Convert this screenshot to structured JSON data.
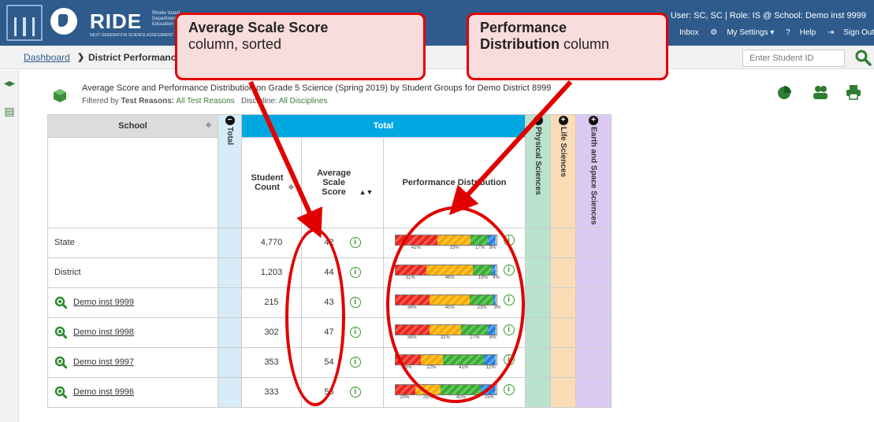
{
  "header": {
    "brand": "RIDE",
    "brand_sub": "Rhode Island Department of Education",
    "brand_tag": "NEXT GENERATION SCIENCE ASSESSMENT",
    "user_line": "User: SC, SC | Role: IS @ School: Demo inst 9999",
    "nav": {
      "inbox": "Inbox",
      "settings": "My Settings ▾",
      "help": "Help",
      "signout": "Sign Out"
    }
  },
  "breadcrumb": {
    "root": "Dashboard",
    "separator": "❯",
    "current": "District Performance"
  },
  "student_search": {
    "placeholder": "Enter Student ID"
  },
  "report": {
    "title": "Average Score and Performance Distribution on Grade 5 Science (Spring 2019) by Student Groups for Demo District 8999",
    "filter_label": "Filtered by",
    "filter_test_reasons": "Test Reasons:",
    "filter_test_reasons_value": "All Test Reasons",
    "filter_discipline": "Discipline:",
    "filter_discipline_value": "All Disciplines"
  },
  "table": {
    "school_header": "School",
    "total_strip": "Total",
    "total_band": "Total",
    "col_student_count": "Student Count",
    "col_avg_scale": "Average Scale Score",
    "col_perf": "Performance Distribution",
    "physical": "Physical Sciences",
    "life": "Life Sciences",
    "earth": "Earth and Space Sciences",
    "rows": [
      {
        "name": "State",
        "link": false,
        "count": "4,770",
        "avg": "42",
        "dist": [
          42,
          33,
          17,
          8
        ],
        "labels": [
          "42%",
          "33%",
          "17%",
          "8%"
        ]
      },
      {
        "name": "District",
        "link": false,
        "count": "1,203",
        "avg": "44",
        "dist": [
          31,
          46,
          19,
          4
        ],
        "labels": [
          "31%",
          "46%",
          "19%",
          "4%"
        ]
      },
      {
        "name": "Demo inst 9999",
        "link": true,
        "count": "215",
        "avg": "43",
        "dist": [
          34,
          40,
          23,
          3
        ],
        "labels": [
          "34%",
          "40%",
          "23%",
          "3%"
        ]
      },
      {
        "name": "Demo inst 9998",
        "link": true,
        "count": "302",
        "avg": "47",
        "dist": [
          34,
          31,
          27,
          8
        ],
        "labels": [
          "34%",
          "31%",
          "27%",
          "8%"
        ]
      },
      {
        "name": "Demo inst 9997",
        "link": true,
        "count": "353",
        "avg": "54",
        "dist": [
          25,
          22,
          41,
          12
        ],
        "labels": [
          "25%",
          "22%",
          "41%",
          "12%"
        ]
      },
      {
        "name": "Demo inst 9996",
        "link": true,
        "count": "333",
        "avg": "56",
        "dist": [
          20,
          25,
          40,
          15
        ],
        "labels": [
          "20%",
          "25%",
          "40%",
          "15%"
        ]
      }
    ]
  },
  "callouts": {
    "avg_bold": "Average Scale Score",
    "avg_rest": "column, sorted",
    "perf_bold_1": "Performance",
    "perf_bold_2": "Distribution",
    "perf_rest": "column"
  },
  "colors": {
    "header": "#2e5b8c",
    "total_band": "#00a8e1",
    "callout_red": "#e00000"
  }
}
